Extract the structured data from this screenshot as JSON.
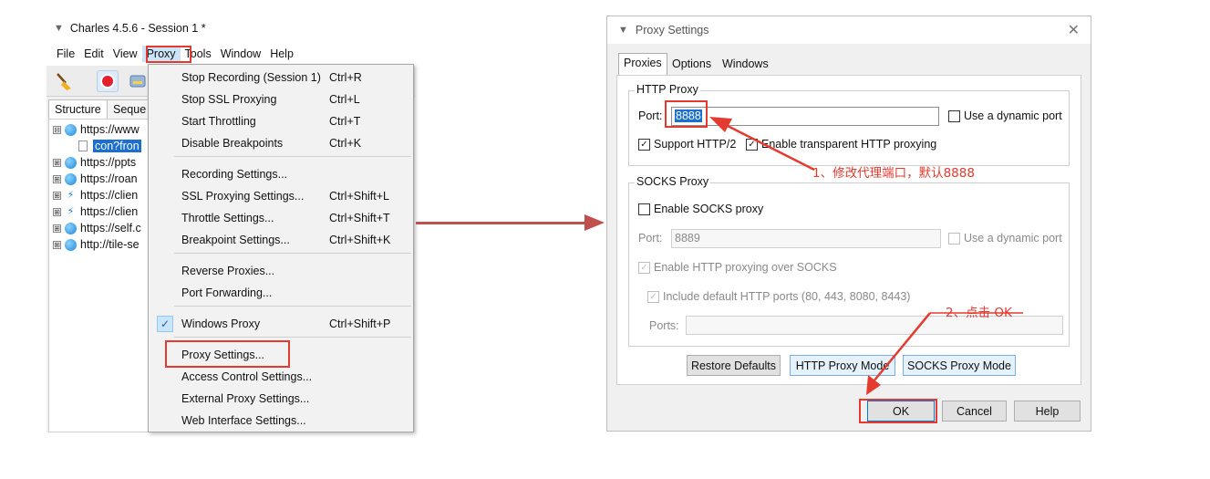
{
  "charles": {
    "title": "Charles 4.5.6 - Session 1 *",
    "menubar": [
      "File",
      "Edit",
      "View",
      "Proxy",
      "Tools",
      "Window",
      "Help"
    ],
    "tabs": [
      "Structure",
      "Seque"
    ],
    "tree": [
      {
        "expander": "⊟",
        "icon": "globe-icon",
        "label": "https://www"
      },
      {
        "expander": "",
        "icon": "document-icon",
        "label": "con?fron",
        "selected": true
      },
      {
        "expander": "⊞",
        "icon": "globe-icon",
        "label": "https://ppts"
      },
      {
        "expander": "⊞",
        "icon": "globe-icon",
        "label": "https://roan"
      },
      {
        "expander": "⊞",
        "icon": "bolt-icon",
        "label": "https://clien"
      },
      {
        "expander": "⊞",
        "icon": "bolt-icon",
        "label": "https://clien"
      },
      {
        "expander": "⊞",
        "icon": "globe-icon",
        "label": "https://self.c"
      },
      {
        "expander": "⊞",
        "icon": "globe-icon",
        "label": "http://tile-se"
      }
    ]
  },
  "proxy_menu": {
    "items": [
      {
        "label": "Stop Recording (Session 1)",
        "shortcut": "Ctrl+R"
      },
      {
        "label": "Stop SSL Proxying",
        "shortcut": "Ctrl+L"
      },
      {
        "label": "Start Throttling",
        "shortcut": "Ctrl+T"
      },
      {
        "label": "Disable Breakpoints",
        "shortcut": "Ctrl+K"
      },
      {
        "label": "Recording Settings...",
        "shortcut": ""
      },
      {
        "label": "SSL Proxying Settings...",
        "shortcut": "Ctrl+Shift+L"
      },
      {
        "label": "Throttle Settings...",
        "shortcut": "Ctrl+Shift+T"
      },
      {
        "label": "Breakpoint Settings...",
        "shortcut": "Ctrl+Shift+K"
      },
      {
        "label": "Reverse Proxies...",
        "shortcut": ""
      },
      {
        "label": "Port Forwarding...",
        "shortcut": ""
      },
      {
        "label": "Windows Proxy",
        "shortcut": "Ctrl+Shift+P",
        "checked": true
      },
      {
        "label": "Proxy Settings...",
        "shortcut": ""
      },
      {
        "label": "Access Control Settings...",
        "shortcut": ""
      },
      {
        "label": "External Proxy Settings...",
        "shortcut": ""
      },
      {
        "label": "Web Interface Settings...",
        "shortcut": ""
      }
    ]
  },
  "dialog": {
    "title": "Proxy Settings",
    "tabs": [
      "Proxies",
      "Options",
      "Windows"
    ],
    "http_proxy": {
      "group_label": "HTTP Proxy",
      "port_label": "Port:",
      "port_value": "8888",
      "dynamic_port_label": "Use a dynamic port",
      "support_http2_label": "Support HTTP/2",
      "transparent_label": "Enable transparent HTTP proxying"
    },
    "socks_proxy": {
      "group_label": "SOCKS Proxy",
      "enable_label": "Enable SOCKS proxy",
      "port_label": "Port:",
      "port_value": "8889",
      "dynamic_port_label": "Use a dynamic port",
      "http_over_socks_label": "Enable HTTP proxying over SOCKS",
      "include_ports_label": "Include default HTTP ports (80, 443, 8080, 8443)",
      "ports_label": "Ports:"
    },
    "buttons": {
      "restore": "Restore Defaults",
      "http_mode": "HTTP Proxy Mode",
      "socks_mode": "SOCKS Proxy Mode",
      "ok": "OK",
      "cancel": "Cancel",
      "help": "Help"
    }
  },
  "annotations": {
    "step1": "1、修改代理端口，默认8888",
    "step2": "2、点击 OK"
  },
  "colors": {
    "annotation_red": "#e53a2f",
    "arrow": "#c0504d",
    "selection_blue": "#1a6fd1"
  }
}
